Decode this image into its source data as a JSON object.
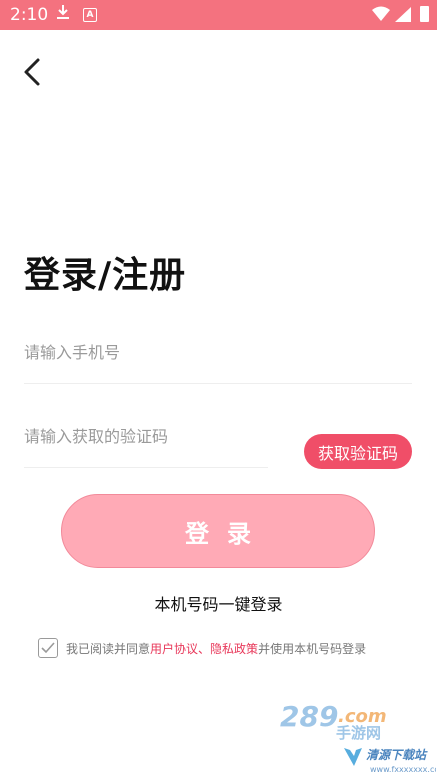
{
  "status_bar": {
    "time": "2:10",
    "icons": [
      "download-icon",
      "a-badge-icon",
      "wifi-icon",
      "signal-icon",
      "battery-icon"
    ]
  },
  "nav": {
    "back_icon": "chevron-left-icon"
  },
  "title": "登录/注册",
  "phone_input": {
    "placeholder": "请输入手机号",
    "value": ""
  },
  "code_input": {
    "placeholder": "请输入获取的验证码",
    "value": ""
  },
  "get_code_button": "获取验证码",
  "login_button": "登录",
  "one_key_login": "本机号码一键登录",
  "agreement": {
    "checked": true,
    "prefix": "我已阅读并同意",
    "user_agreement": "用户协议",
    "separator": "、",
    "privacy_policy": "隐私政策",
    "suffix": "并使用本机号码登录"
  },
  "colors": {
    "status_bar": "#f4727f",
    "accent": "#f04e68",
    "login_button": "#ffaab6",
    "link": "#e8385a"
  }
}
